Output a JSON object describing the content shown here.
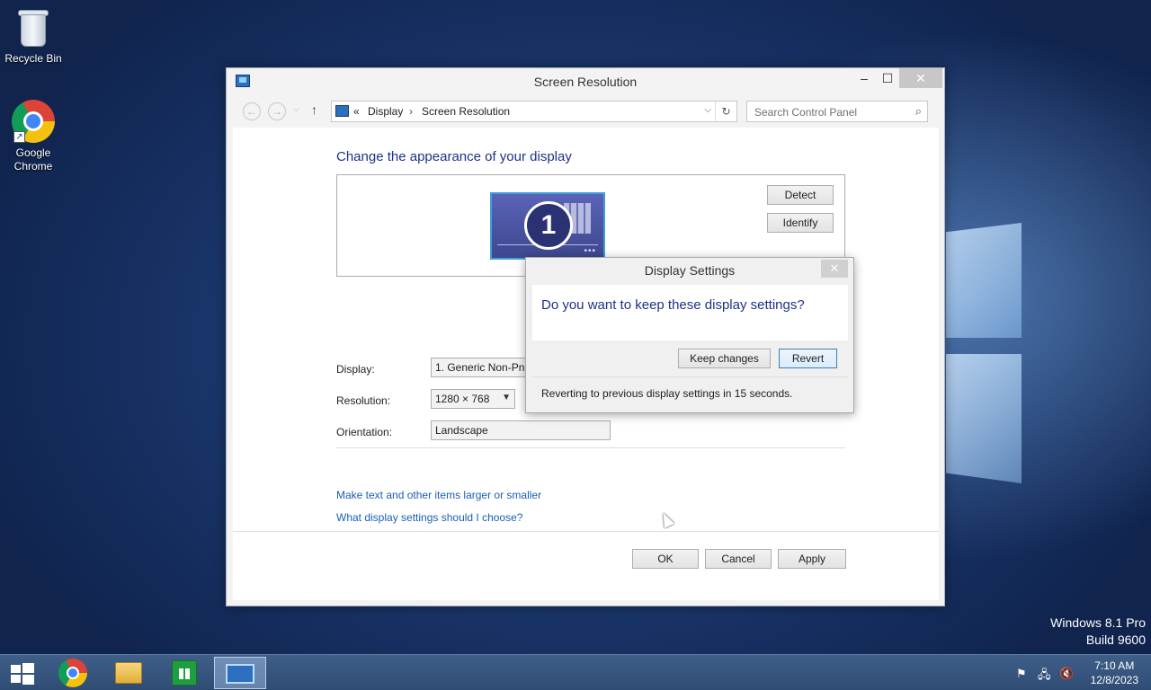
{
  "desktop": {
    "icons": [
      {
        "label": "Recycle Bin"
      },
      {
        "label": "Google Chrome"
      }
    ],
    "watermark": {
      "line1": "Windows 8.1 Pro",
      "line2": "Build 9600"
    }
  },
  "window": {
    "title": "Screen Resolution",
    "controls": {
      "minimize": "–",
      "maximize": "☐",
      "close": "✕"
    },
    "address": {
      "separator": "«",
      "crumbs": [
        "Display",
        "Screen Resolution"
      ],
      "crumb_arrow": "›",
      "dropdown": "⌵",
      "refresh": "↻"
    },
    "search": {
      "placeholder": "Search Control Panel",
      "icon": "⌕"
    },
    "heading": "Change the appearance of your display",
    "monitor": {
      "number": "1",
      "dots": "•••"
    },
    "buttons": {
      "detect": "Detect",
      "identify": "Identify",
      "ok": "OK",
      "cancel": "Cancel",
      "apply": "Apply"
    },
    "fields": [
      {
        "label": "Display:",
        "value": "1. Generic Non-PnP Monitor"
      },
      {
        "label": "Resolution:",
        "value": "1280 × 768"
      },
      {
        "label": "Orientation:",
        "value": "Landscape"
      }
    ],
    "links": [
      "Make text and other items larger or smaller",
      "What display settings should I choose?"
    ]
  },
  "dialog": {
    "title": "Display Settings",
    "close": "✕",
    "question": "Do you want to keep these display settings?",
    "keep_label": "Keep changes",
    "revert_label": "Revert",
    "countdown": "Reverting to previous display settings in 15 seconds."
  },
  "taskbar": {
    "clock": {
      "time": "7:10 AM",
      "date": "12/8/2023"
    },
    "tray": {
      "flag": "⚑",
      "network": "🖧",
      "volume": "🔇"
    }
  },
  "colors": {
    "accent": "#1e3287",
    "link": "#1a5fb4",
    "taskbar": "#2f4c74"
  }
}
